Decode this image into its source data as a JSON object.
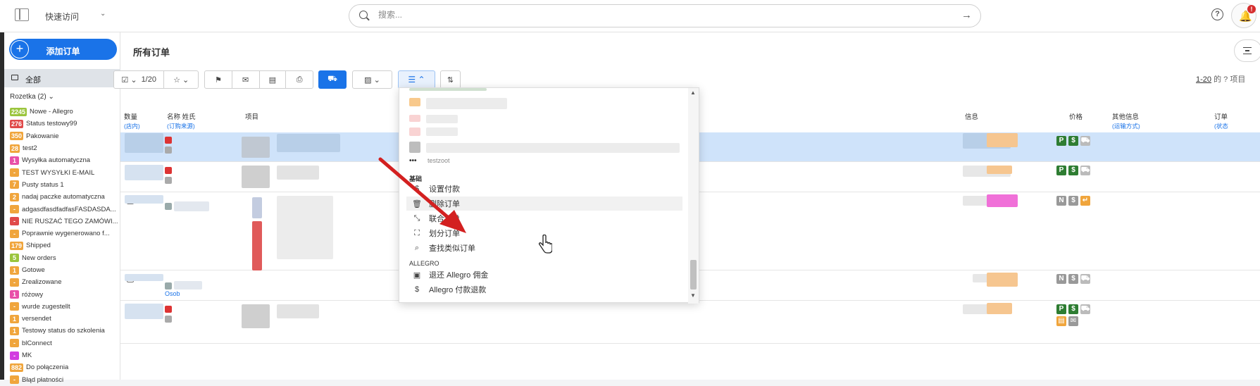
{
  "topbar": {
    "quick_access": "快速访问",
    "search_placeholder": "搜索..."
  },
  "sidebar": {
    "add_order": "添加订单",
    "all": "全部",
    "group": "Rozetka (2)",
    "statuses": [
      {
        "count": "2245",
        "label": "Nowe - Allegro",
        "color": "#9bc53d"
      },
      {
        "count": "276",
        "label": "Status testowy99",
        "color": "#e04a4a"
      },
      {
        "count": "350",
        "label": "Pakowanie",
        "color": "#f0a53c"
      },
      {
        "count": "28",
        "label": "test2",
        "color": "#f0a53c"
      },
      {
        "count": "1",
        "label": "Wysyłka automatyczna",
        "color": "#e84fa8"
      },
      {
        "count": "-",
        "label": "TEST WYSYŁKI E-MAIL",
        "color": "#f0a53c"
      },
      {
        "count": "7",
        "label": "Pusty status 1",
        "color": "#f0a53c"
      },
      {
        "count": "2",
        "label": "nadaj paczke automatyczna",
        "color": "#f0a53c"
      },
      {
        "count": "-",
        "label": "adgasdfasdfadfasFASDASDA...",
        "color": "#f0a53c"
      },
      {
        "count": "-",
        "label": "NIE RUSZAĆ TEGO ZAMÓWI...",
        "color": "#e04a4a"
      },
      {
        "count": "-",
        "label": "Poprawnie wygenerowano f...",
        "color": "#f0a53c"
      },
      {
        "count": "179",
        "label": "Shipped",
        "color": "#f0a53c"
      },
      {
        "count": "5",
        "label": "New orders",
        "color": "#9bc53d"
      },
      {
        "count": "1",
        "label": "Gotowe",
        "color": "#f0a53c"
      },
      {
        "count": "-",
        "label": "Zrealizowane",
        "color": "#f0a53c"
      },
      {
        "count": "1",
        "label": "różowy",
        "color": "#e84fa8"
      },
      {
        "count": "-",
        "label": "wurde zugestellt",
        "color": "#f0a53c"
      },
      {
        "count": "1",
        "label": "versendet",
        "color": "#f0a53c"
      },
      {
        "count": "1",
        "label": "Testowy status do szkolenia",
        "color": "#f0a53c"
      },
      {
        "count": "-",
        "label": "blConnect",
        "color": "#f0a53c"
      },
      {
        "count": "-",
        "label": "MK",
        "color": "#d23ce0"
      },
      {
        "count": "882",
        "label": "Do połączenia",
        "color": "#f0a53c"
      },
      {
        "count": "-",
        "label": "Błąd płatności",
        "color": "#f0a53c"
      }
    ]
  },
  "main": {
    "title": "所有订单",
    "selection_count": "1/20",
    "pager_link": "1-20",
    "pager_rest": " 的 ? 项目",
    "columns": {
      "qty": "数量",
      "qty_sub": "(店内)",
      "name": "名称 姓氏",
      "name_sub": "(订购来源)",
      "items": "项目",
      "info": "信息",
      "price": "价格",
      "other": "其他信息",
      "other_sub": "(运输方式)",
      "order": "订单",
      "order_sub": "(状态"
    },
    "row_texts": {
      "row4_name": "Osob"
    }
  },
  "dropdown": {
    "section_basic": "基础",
    "section_allegro": "ALLEGRO",
    "partial_item": "testzoot",
    "items": [
      {
        "icon": "$",
        "label": "设置付款",
        "name": "set-payment"
      },
      {
        "icon": "🗑",
        "label": "删除订单",
        "name": "delete-order"
      },
      {
        "icon": "⤡",
        "label": "联合订单",
        "name": "merge-orders"
      },
      {
        "icon": "⛶",
        "label": "划分订单",
        "name": "split-order"
      },
      {
        "icon": "⌕",
        "label": "查找类似订单",
        "name": "find-similar-orders"
      }
    ],
    "allegro_items": [
      {
        "icon": "▣",
        "label": "退还 Allegro 佣金",
        "name": "refund-allegro-commission"
      },
      {
        "icon": "$",
        "label": "Allegro 付款退款",
        "name": "allegro-payment-refund"
      }
    ]
  },
  "colors": {
    "accent": "#1a73e8",
    "arrow": "#d32020"
  }
}
